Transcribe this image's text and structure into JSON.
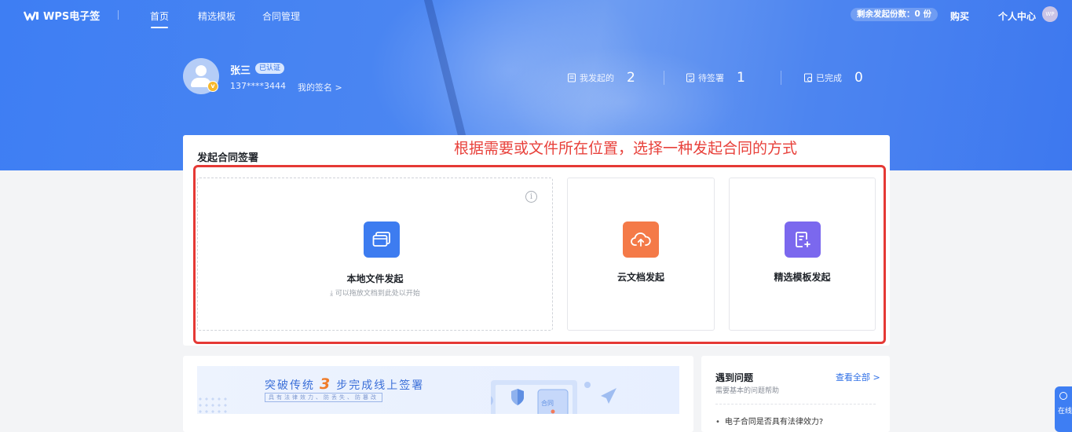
{
  "brand": {
    "name": "WPS电子签"
  },
  "nav": {
    "items": [
      "首页",
      "精选模板",
      "合同管理"
    ],
    "active_index": 0
  },
  "header_right": {
    "quota_label": "剩余发起份数：0 份",
    "buy": "购买",
    "user_center": "个人中心",
    "avatar_text": "WP"
  },
  "user": {
    "name": "张三",
    "verified": "已认证",
    "phone": "137****3444",
    "my_signature": "我的签名  >"
  },
  "stats": [
    {
      "label": "我发起的",
      "value": "2",
      "icon": "document-icon"
    },
    {
      "label": "待签署",
      "value": "1",
      "icon": "pending-sign-icon"
    },
    {
      "label": "已完成",
      "value": "0",
      "icon": "completed-icon"
    }
  ],
  "main": {
    "title": "发起合同签署",
    "annotation": "根据需要或文件所在位置，选择一种发起合同的方式",
    "options": [
      {
        "label": "本地文件发起",
        "hint": "可以拖放文档到此处以开始",
        "color": "#3d7cf0",
        "icon": "folder-icon"
      },
      {
        "label": "云文档发起",
        "color": "#f47a48",
        "icon": "cloud-upload-icon"
      },
      {
        "label": "精选模板发起",
        "color": "#7b68ee",
        "icon": "template-edit-icon"
      }
    ],
    "info_icon": "i"
  },
  "banner": {
    "title_pre": "突破传统",
    "title_num": "3",
    "title_post": "步完成线上签署",
    "subtitle": "具有法律效力、防丢失、防篡改",
    "illus_label": "合同"
  },
  "faq": {
    "title": "遇到问题",
    "view_all": "查看全部 >",
    "subtitle": "需要基本的问题帮助",
    "items": [
      "电子合同是否具有法律效力?"
    ]
  },
  "side_float": {
    "label": "在线"
  },
  "colors": {
    "primary": "#3e7ef3",
    "annotation": "#e53935"
  }
}
